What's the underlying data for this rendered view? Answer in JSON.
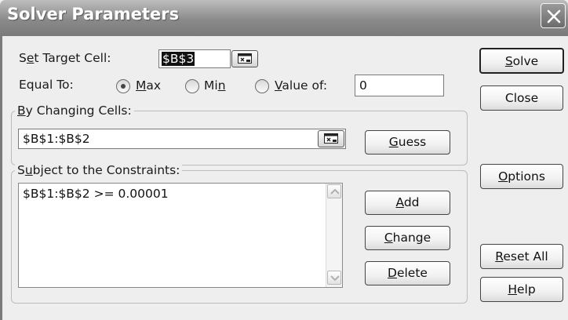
{
  "window": {
    "title": "Solver Parameters",
    "close_icon": "close-icon"
  },
  "target": {
    "label_pre": "S",
    "label_u": "e",
    "label_post": "t Target Cell:",
    "value": "$B$3",
    "ref_icon": "collapse-dialog-icon"
  },
  "equal_to": {
    "label": "Equal To:",
    "selected": "Max",
    "options": [
      {
        "pre": "",
        "u": "M",
        "post": "ax",
        "selected": true
      },
      {
        "pre": "Mi",
        "u": "n",
        "post": "",
        "selected": false
      },
      {
        "pre": "",
        "u": "V",
        "post": "alue of:",
        "selected": false
      }
    ],
    "value_of": "0"
  },
  "changing": {
    "label_u": "B",
    "label_post": "y Changing Cells:",
    "value": "$B$1:$B$2",
    "ref_icon": "collapse-dialog-icon",
    "guess": {
      "u": "G",
      "post": "uess"
    }
  },
  "constraints": {
    "label_pre": "S",
    "label_u": "u",
    "label_post": "bject to the Constraints:",
    "items": [
      "$B$1:$B$2 >= 0.00001"
    ],
    "add": {
      "u": "A",
      "post": "dd"
    },
    "change": {
      "u": "C",
      "post": "hange"
    },
    "delete": {
      "u": "D",
      "post": "elete"
    }
  },
  "side_buttons": {
    "solve": {
      "u": "S",
      "post": "olve"
    },
    "close": "Close",
    "options": {
      "u": "O",
      "post": "ptions"
    },
    "reset": {
      "u": "R",
      "post": "eset All"
    },
    "help": {
      "u": "H",
      "post": "elp"
    }
  }
}
